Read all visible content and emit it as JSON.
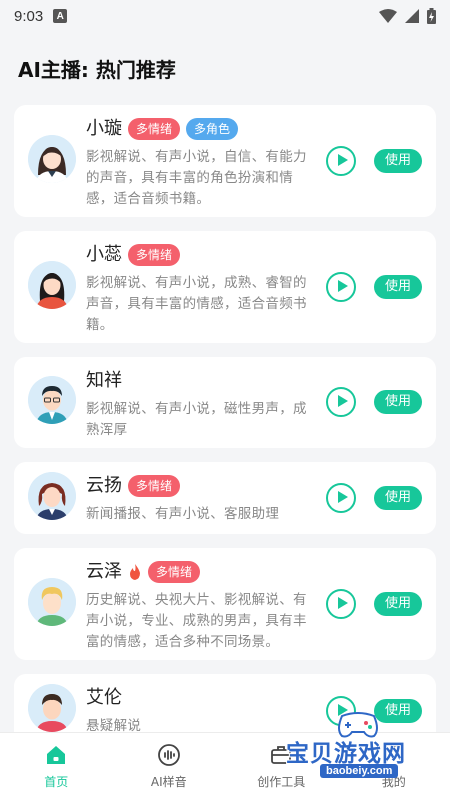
{
  "status_bar": {
    "time": "9:03",
    "notification_glyph": "A"
  },
  "header": {
    "title": "AI主播: 热门推荐"
  },
  "voices": [
    {
      "name": "小璇",
      "tags": [
        "多情绪",
        "多角色"
      ],
      "hot": false,
      "description": "影视解说、有声小说，自信、有能力的声音，具有丰富的角色扮演和情感，适合音频书籍。",
      "use_label": "使用"
    },
    {
      "name": "小蕊",
      "tags": [
        "多情绪"
      ],
      "hot": false,
      "description": "影视解说、有声小说，成熟、睿智的声音，具有丰富的情感，适合音频书籍。",
      "use_label": "使用"
    },
    {
      "name": "知祥",
      "tags": [],
      "hot": false,
      "description": "影视解说、有声小说，磁性男声，成熟浑厚",
      "use_label": "使用"
    },
    {
      "name": "云扬",
      "tags": [
        "多情绪"
      ],
      "hot": false,
      "description": "新闻播报、有声小说、客服助理",
      "use_label": "使用"
    },
    {
      "name": "云泽",
      "tags": [
        "多情绪"
      ],
      "hot": true,
      "description": "历史解说、央视大片、影视解说、有声小说，专业、成熟的男声，具有丰富的情感，适合多种不同场景。",
      "use_label": "使用"
    },
    {
      "name": "艾伦",
      "tags": [],
      "hot": false,
      "description": "悬疑解说",
      "use_label": "使用"
    }
  ],
  "tabbar": {
    "tabs": [
      {
        "label": "首页",
        "icon": "home-icon",
        "active": true
      },
      {
        "label": "AI样音",
        "icon": "voice-wave-icon",
        "active": false
      },
      {
        "label": "创作工具",
        "icon": "toolbox-icon",
        "active": false
      },
      {
        "label": "我的",
        "icon": "profile-icon",
        "active": false
      }
    ]
  },
  "watermark": {
    "text": "宝贝游戏网",
    "url": "baobeiy.com"
  },
  "colors": {
    "accent": "#17c79a",
    "tag_red": "#f4606c",
    "tag_blue": "#55a9ee",
    "background": "#f4f5f7"
  }
}
